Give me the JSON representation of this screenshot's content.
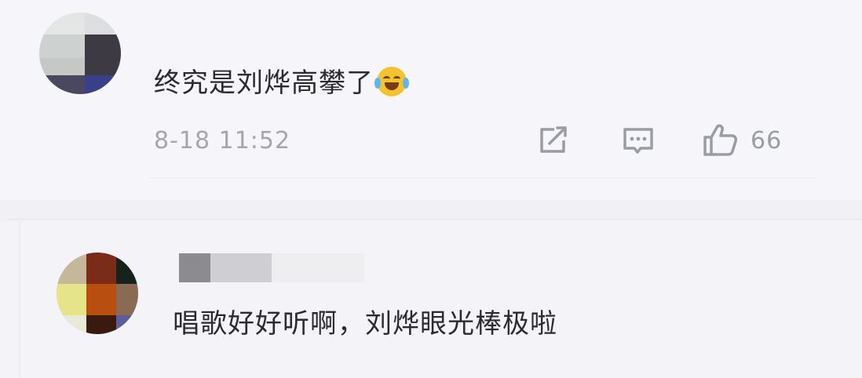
{
  "comments": [
    {
      "text": "终究是刘烨高攀了",
      "emoji_icon": "laughing-with-tears-icon",
      "timestamp": "8-18 11:52",
      "actions": {
        "share_icon": "share-icon",
        "reply_icon": "comment-icon",
        "like_icon": "thumbs-up-icon",
        "like_count": "66"
      }
    },
    {
      "text": "唱歌好好听啊，刘烨眼光棒极啦",
      "username_obscured": true
    }
  ],
  "colors": {
    "background": "#f5f4f8",
    "text": "#2b2b2f",
    "muted": "#a5a6ad",
    "icon": "#9a9ca4"
  }
}
